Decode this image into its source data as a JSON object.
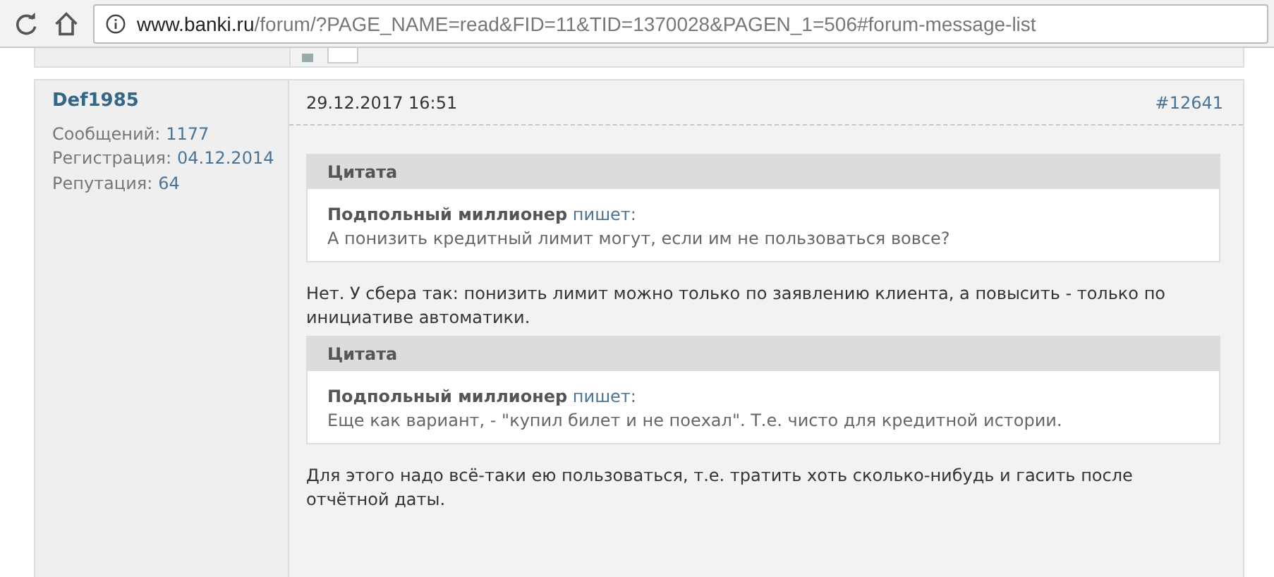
{
  "browser": {
    "url_host": "www.banki.ru",
    "url_path": "/forum/?PAGE_NAME=read&FID=11&TID=1370028&PAGEN_1=506#forum-message-list"
  },
  "post": {
    "author": "Def1985",
    "stats": [
      {
        "label": "Сообщений:",
        "value": "1177"
      },
      {
        "label": "Регистрация:",
        "value": "04.12.2014"
      },
      {
        "label": "Репутация:",
        "value": "64"
      }
    ],
    "date": "29.12.2017 16:51",
    "number": "#12641",
    "body": [
      {
        "kind": "quote",
        "title": "Цитата",
        "author": "Подпольный миллионер",
        "verb": "пишет:",
        "text": "А понизить кредитный лимит могут, если им не пользоваться вовсе?"
      },
      {
        "kind": "text",
        "text": "Нет. У сбера так: понизить лимит можно только по заявлению клиента, а повысить - только по инициативе автоматики."
      },
      {
        "kind": "quote",
        "title": "Цитата",
        "author": "Подпольный миллионер",
        "verb": "пишет:",
        "text": "Еще как вариант, - \"купил билет и не поехал\". Т.е. чисто для кредитной истории."
      },
      {
        "kind": "text",
        "text": "Для этого надо всё-таки ею пользоваться, т.е. тратить хоть сколько-нибудь и гасить после отчётной даты."
      }
    ]
  }
}
